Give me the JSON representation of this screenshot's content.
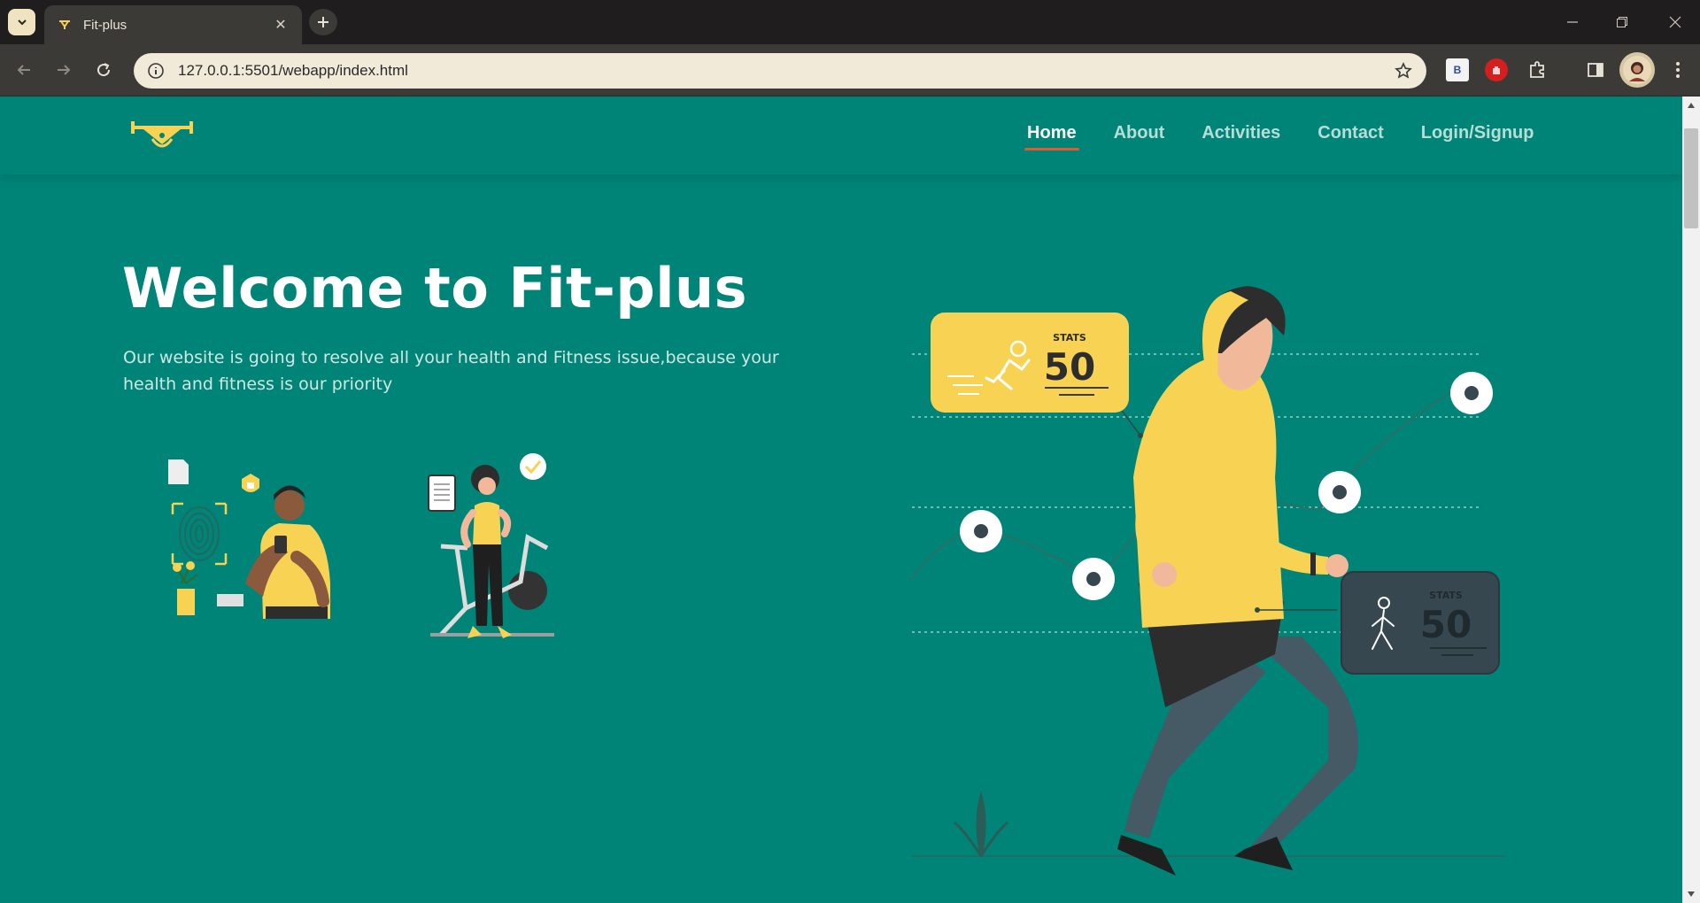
{
  "browser": {
    "tab_title": "Fit-plus",
    "url": "127.0.0.1:5501/webapp/index.html",
    "extension_b_label": "B"
  },
  "site": {
    "nav": [
      "Home",
      "About",
      "Activities",
      "Contact",
      "Login/Signup"
    ],
    "active_nav": "Home",
    "hero_title": "Welcome to Fit-plus",
    "hero_description": "Our website is going to resolve all your health and Fitness issue,because your health and fitness is our priority",
    "stats_cards": [
      {
        "label": "STATS",
        "value": "50"
      },
      {
        "label": "STATS",
        "value": "50"
      }
    ]
  },
  "colors": {
    "page_bg": "#008477",
    "accent_yellow": "#f8d253",
    "active_underline": "#e05a2b",
    "dark_card": "#37474f"
  }
}
